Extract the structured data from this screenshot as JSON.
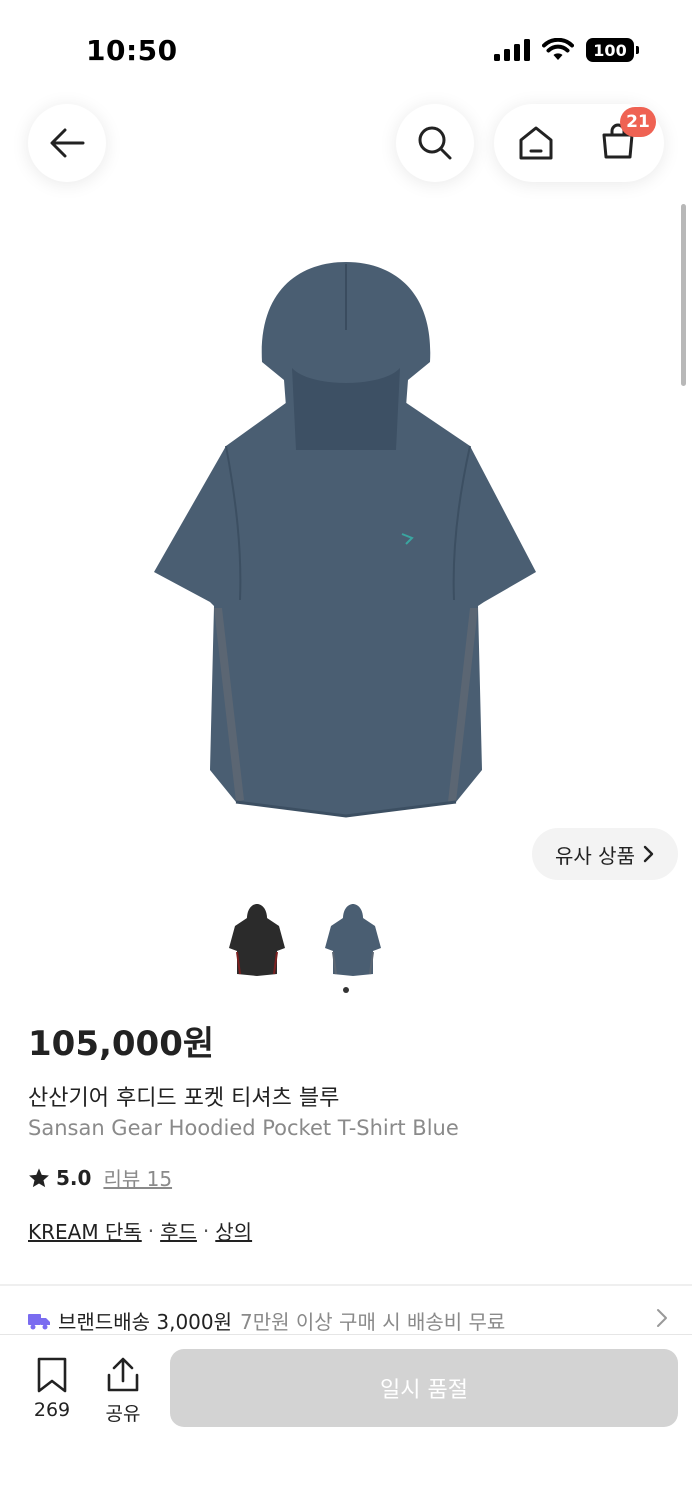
{
  "status_bar": {
    "time": "10:50",
    "battery": "100"
  },
  "nav": {
    "cart_count": "21"
  },
  "product": {
    "similar_label": "유사 상품",
    "price": "105,000원",
    "name_ko": "산산기어 후디드 포켓 티셔츠 블루",
    "name_en": "Sansan Gear Hoodied Pocket T-Shirt Blue",
    "rating": "5.0",
    "review_label": "리뷰 15",
    "tags": [
      "KREAM 단독",
      "후드",
      "상의"
    ],
    "shirt_color": "#4a5e72"
  },
  "shipping": {
    "main": "브랜드배송 3,000원",
    "sub": "7만원 이상 구매 시 배송비 무료",
    "truck_color": "#7a6cf0"
  },
  "bottom_bar": {
    "bookmark_count": "269",
    "share_label": "공유",
    "soldout_label": "일시 품절"
  }
}
